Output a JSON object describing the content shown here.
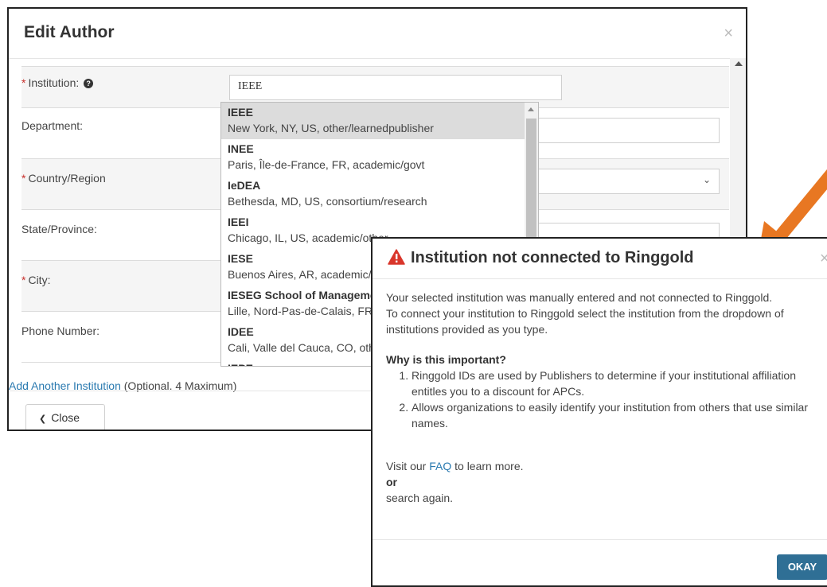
{
  "edit_modal": {
    "title": "Edit Author",
    "close_glyph": "×",
    "fields": [
      {
        "label": "Institution:",
        "required": true,
        "value": "IEEE"
      },
      {
        "label": "Department:",
        "required": false,
        "value": ""
      },
      {
        "label": "Country/Region",
        "required": true,
        "value": ""
      },
      {
        "label": "State/Province:",
        "required": false,
        "value": ""
      },
      {
        "label": "City:",
        "required": true,
        "value": ""
      },
      {
        "label": "Phone Number:",
        "required": false,
        "value": ""
      }
    ],
    "required_marker": "*",
    "help_icon": "?",
    "add_institution_link": "Add Another Institution",
    "add_institution_note": "(Optional. 4 Maximum)",
    "close_button": "Close"
  },
  "dropdown": {
    "items": [
      {
        "name": "IEEE",
        "location": "New York, NY, US, other/learnedpublisher"
      },
      {
        "name": "INEE",
        "location": "Paris, Île-de-France, FR, academic/govt"
      },
      {
        "name": "IeDEA",
        "location": "Bethesda, MD, US, consortium/research"
      },
      {
        "name": "IEEI",
        "location": "Chicago, IL, US, academic/other"
      },
      {
        "name": "IESE",
        "location": "Buenos Aires, AR, academic/univ"
      },
      {
        "name": "IESEG School of Management",
        "location": "Lille, Nord-Pas-de-Calais, FR, academic/univ"
      },
      {
        "name": "IDEE",
        "location": "Cali, Valle del Cauca, CO, other/other"
      },
      {
        "name": "IEPE",
        "location": ""
      }
    ],
    "active_index": 0
  },
  "ringgold_modal": {
    "title": "Institution not connected to Ringgold",
    "close_glyph": "×",
    "intro_line1": "Your selected institution was manually entered and not connected to Ringgold.",
    "intro_line2": "To connect your institution to Ringgold select the institution from the dropdown of institutions provided as you type.",
    "why_heading": "Why is this important?",
    "reasons": [
      "Ringgold IDs are used by Publishers to determine if your institutional affiliation entitles you to a discount for APCs.",
      "Allows organizations to easily identify your institution from others that use similar names."
    ],
    "visit_prefix": "Visit our",
    "faq_link": "FAQ",
    "visit_suffix": "to learn more.",
    "or_text": "or",
    "search_again": "search again.",
    "okay_button": "OKAY"
  },
  "colors": {
    "link": "#2a7ab0",
    "required": "#c9302c",
    "warning": "#d9362b",
    "arrow": "#e87722",
    "primary_button": "#2f6f95"
  },
  "icons": {
    "warning": "warning-triangle-icon",
    "close": "close-icon",
    "help": "question-circle-icon",
    "chevron_left": "chevron-left-icon",
    "chevron_down": "chevron-down-icon"
  }
}
